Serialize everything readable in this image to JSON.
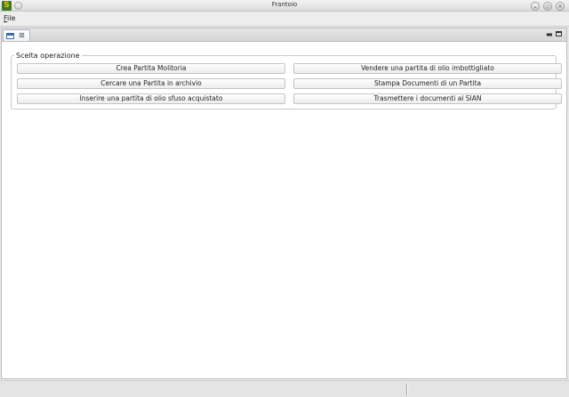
{
  "window": {
    "title": "Frantoio",
    "app_icon_letter": "S",
    "controls": {
      "minimize_icon": "chevron-down-icon",
      "maximize_icon": "restore-icon",
      "close_icon": "close-icon"
    }
  },
  "menubar": {
    "file_mnemonic": "F",
    "file_rest": "ile"
  },
  "view": {
    "tab_icon": "window-view-icon",
    "tab_close_glyph": "⊠",
    "minimize_glyph": "▭"
  },
  "group": {
    "legend": "Scelta operazione",
    "buttons": [
      "Crea Partita Molitoria",
      "Vendere una partita di olio imbottigliato",
      "Cercare una Partita in archivio",
      "Stampa Documenti di un Partita",
      "Inserire una partita di olio sfuso acquistato",
      "Trasmettere i documenti al SIAN"
    ]
  }
}
